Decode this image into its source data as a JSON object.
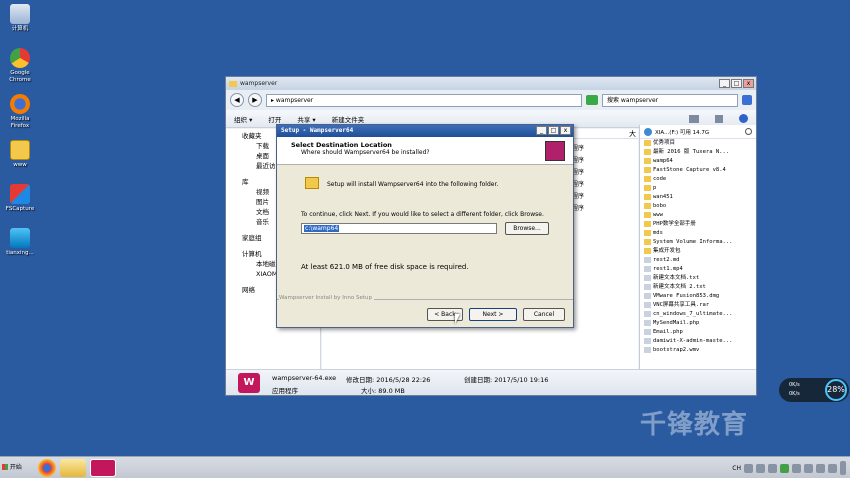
{
  "desktop": {
    "icons": [
      {
        "label": "计算机"
      },
      {
        "label": "Google Chrome"
      },
      {
        "label": "Mozilla Firefox"
      },
      {
        "label": "www"
      },
      {
        "label": "FSCapture"
      },
      {
        "label": "tianxing..."
      }
    ]
  },
  "explorer": {
    "title": "wampserver",
    "address": "▸ wampserver",
    "search_placeholder": "搜索 wampserver",
    "toolbar": [
      "组织 ▾",
      "打开",
      "共享 ▾",
      "新建文件夹"
    ],
    "nav": {
      "favorites": "收藏夹",
      "downloads": "下载",
      "desktop": "桌面",
      "recent": "最近访",
      "library": "库",
      "video": "视频",
      "pictures": "图片",
      "docs": "文档",
      "music": "音乐",
      "homegroup": "家庭组",
      "computer": "计算机",
      "local": "本地磁",
      "xiaom": "XIAOM",
      "network": "网络"
    },
    "column_size": "大",
    "partial_text": [
      "程序",
      "程序",
      "程序",
      "程序",
      "程序",
      "程序"
    ],
    "status": {
      "filename": "wampserver-64.exe",
      "modified": "修改日期: 2016/5/28 22:26",
      "created": "创建日期: 2017/5/10 19:16",
      "type": "应用程序",
      "size": "大小: 89.0 MB"
    }
  },
  "right_panel": {
    "drive_label": "XIA...(F:) 可用 14.7G",
    "items": [
      "优秀项目",
      "最新 2016 版 Tuxera N...",
      "wamp64",
      "FastStone Capture v8.4",
      "code",
      "p",
      "wan451",
      "bobo",
      "www",
      "PHP数学全部手册",
      "mds",
      "System Volume Informa...",
      "集成开发包",
      "rest2.md",
      "rest1.mp4",
      "新建文本文档.txt",
      "新建文本文档 2.txt",
      "VMware Fusion853.dmg",
      "VNC屏幕共享工具.rar",
      "cn_windows_7_ultimate...",
      "MySendMail.php",
      "Email.php",
      "damiwit-X-admin-maste...",
      "bootstrap2.wmv"
    ]
  },
  "setup": {
    "title": "Setup - Wampserver64",
    "heading": "Select Destination Location",
    "subheading": "Where should Wampserver64 be installed?",
    "install_text": "Setup will install Wampserver64 into the following folder.",
    "continue_text": "To continue, click Next. If you would like to select a different folder, click Browse.",
    "path_value": "c:\\wamp64",
    "browse_label": "Browse...",
    "space_text": "At least 621.0 MB of free disk space is required.",
    "footer_label": "Wampserver Install by Inno Setup",
    "back_label": "< Back",
    "next_label": "Next >",
    "cancel_label": "Cancel"
  },
  "taskbar": {
    "start_label": "开始",
    "lang": "CH"
  },
  "net_widget": {
    "up": "0K/s",
    "down": "0K/s",
    "percent": "28%"
  },
  "watermark": "千锋教育"
}
